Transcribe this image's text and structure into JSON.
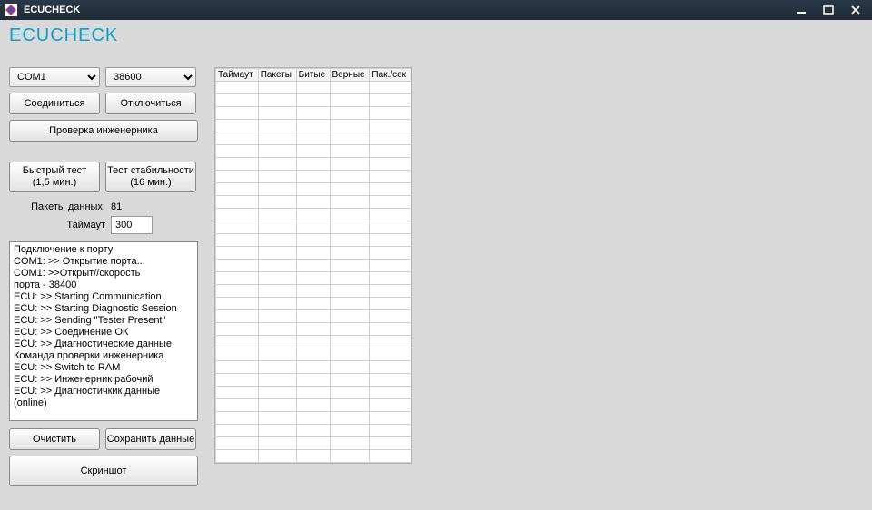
{
  "window": {
    "title": "ECUCHECK"
  },
  "app_title": "ECUCHECK",
  "combo": {
    "port": "COM1",
    "baud": "38600"
  },
  "buttons": {
    "connect": "Соединиться",
    "disconnect": "Отключиться",
    "engineer_check": "Проверка инженерника",
    "quick_test": "Быстрый тест\n(1,5 мин.)",
    "stability_test": "Тест стабильности\n(16 мин.)",
    "clear": "Очистить",
    "save_data": "Сохранить данные",
    "screenshot": "Скриншот"
  },
  "fields": {
    "packets_label": "Пакеты данных:",
    "packets_value": "81",
    "timeout_label": "Таймаут",
    "timeout_value": "300"
  },
  "log_lines": [
    "Подключение к порту",
    "COM1: >> Открытие порта...",
    "COM1: >>Открыт//скорость",
    "порта - 38400",
    "ECU: >> Starting Communication",
    "ECU: >> Starting Diagnostic Session",
    "ECU: >> Sending \"Tester Present\"",
    "ECU: >> Соединение ОК",
    "ECU: >> Диагностические данные",
    "Команда проверки инженерника",
    "ECU: >> Switch to RAM",
    "ECU: >> Инженерник рабочий",
    "ECU: >> Диагностичкик данные",
    "(online)"
  ],
  "grid": {
    "headers": [
      "Таймаут",
      "Пакеты",
      "Битые",
      "Верные",
      "Пак./сек"
    ],
    "empty_rows": 30
  }
}
